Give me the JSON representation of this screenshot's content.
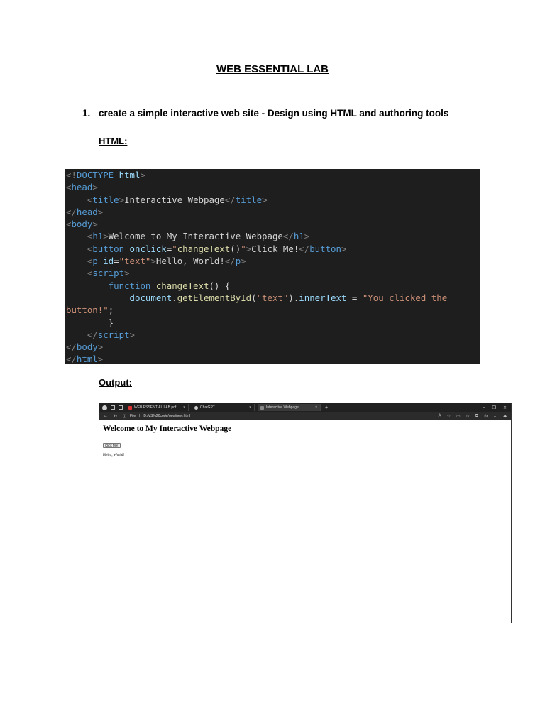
{
  "doc": {
    "title": "WEB ESSENTIAL LAB",
    "item_number": "1.",
    "item_text": "create a simple interactive web site - Design using HTML and authoring tools",
    "html_label": "HTML:",
    "output_label": "Output:"
  },
  "code_lines": [
    [
      [
        "p",
        "<!"
      ],
      [
        "t",
        "DOCTYPE "
      ],
      [
        "a",
        "html"
      ],
      [
        "p",
        ">"
      ]
    ],
    [
      [
        "p",
        "<"
      ],
      [
        "t",
        "head"
      ],
      [
        "p",
        ">"
      ]
    ],
    [
      [
        "w",
        "    "
      ],
      [
        "p",
        "<"
      ],
      [
        "t",
        "title"
      ],
      [
        "p",
        ">"
      ],
      [
        "w",
        "Interactive Webpage"
      ],
      [
        "p",
        "</"
      ],
      [
        "t",
        "title"
      ],
      [
        "p",
        ">"
      ]
    ],
    [
      [
        "p",
        "</"
      ],
      [
        "t",
        "head"
      ],
      [
        "p",
        ">"
      ]
    ],
    [
      [
        "p",
        "<"
      ],
      [
        "t",
        "body"
      ],
      [
        "p",
        ">"
      ]
    ],
    [
      [
        "w",
        "    "
      ],
      [
        "p",
        "<"
      ],
      [
        "t",
        "h1"
      ],
      [
        "p",
        ">"
      ],
      [
        "w",
        "Welcome to My Interactive Webpage"
      ],
      [
        "p",
        "</"
      ],
      [
        "t",
        "h1"
      ],
      [
        "p",
        ">"
      ]
    ],
    [
      [
        "w",
        "    "
      ],
      [
        "p",
        "<"
      ],
      [
        "t",
        "button "
      ],
      [
        "a",
        "onclick"
      ],
      [
        "w",
        "="
      ],
      [
        "s",
        "\""
      ],
      [
        "f",
        "changeText"
      ],
      [
        "w",
        "()"
      ],
      [
        "s",
        "\""
      ],
      [
        "p",
        ">"
      ],
      [
        "w",
        "Click Me!"
      ],
      [
        "p",
        "</"
      ],
      [
        "t",
        "button"
      ],
      [
        "p",
        ">"
      ]
    ],
    [
      [
        "w",
        "    "
      ],
      [
        "p",
        "<"
      ],
      [
        "t",
        "p "
      ],
      [
        "a",
        "id"
      ],
      [
        "w",
        "="
      ],
      [
        "s",
        "\"text\""
      ],
      [
        "p",
        ">"
      ],
      [
        "w",
        "Hello, World!"
      ],
      [
        "p",
        "</"
      ],
      [
        "t",
        "p"
      ],
      [
        "p",
        ">"
      ]
    ],
    [
      [
        "w",
        "    "
      ],
      [
        "p",
        "<"
      ],
      [
        "t",
        "script"
      ],
      [
        "p",
        ">"
      ]
    ],
    [
      [
        "w",
        "        "
      ],
      [
        "k",
        "function "
      ],
      [
        "f",
        "changeText"
      ],
      [
        "w",
        "() {"
      ]
    ],
    [
      [
        "w",
        "            "
      ],
      [
        "a",
        "document"
      ],
      [
        "w",
        "."
      ],
      [
        "f",
        "getElementById"
      ],
      [
        "w",
        "("
      ],
      [
        "s",
        "\"text\""
      ],
      [
        "w",
        ")."
      ],
      [
        "a",
        "innerText"
      ],
      [
        "w",
        " = "
      ],
      [
        "s",
        "\"You clicked the"
      ]
    ],
    [
      [
        "s",
        "button!\""
      ],
      [
        "w",
        ";"
      ]
    ],
    [
      [
        "w",
        "        }"
      ]
    ],
    [
      [
        "w",
        "    "
      ],
      [
        "p",
        "</"
      ],
      [
        "t",
        "script"
      ],
      [
        "p",
        ">"
      ]
    ],
    [
      [
        "p",
        "</"
      ],
      [
        "t",
        "body"
      ],
      [
        "p",
        ">"
      ]
    ],
    [
      [
        "p",
        "</"
      ],
      [
        "t",
        "html"
      ],
      [
        "p",
        ">"
      ]
    ]
  ],
  "browser": {
    "tabs": [
      {
        "label": "WEB ESSENTIAL LAB.pdf",
        "icon": "pdf-icon"
      },
      {
        "label": "ChatGPT",
        "icon": "chatgpt-icon"
      },
      {
        "label": "Interactive Webpage",
        "icon": "document-icon"
      }
    ],
    "tab_close": "×",
    "new_tab": "+",
    "url_scheme": "File",
    "url": "D:/VS%20code/new/new.html",
    "page_heading": "Welcome to My Interactive Webpage",
    "button_label": "Click Me!",
    "paragraph": "Hello, World!"
  }
}
